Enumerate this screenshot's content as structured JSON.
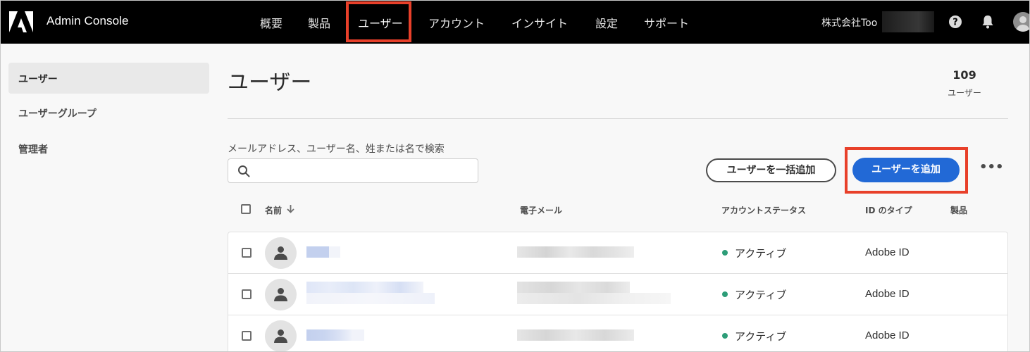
{
  "header": {
    "app_title": "Admin Console",
    "nav": [
      "概要",
      "製品",
      "ユーザー",
      "アカウント",
      "インサイト",
      "設定",
      "サポート"
    ],
    "active_nav": "ユーザー",
    "org_name": "株式会社Too"
  },
  "sidebar": {
    "items": [
      {
        "label": "ユーザー",
        "active": true
      },
      {
        "label": "ユーザーグループ",
        "active": false
      },
      {
        "label": "管理者",
        "active": false
      }
    ]
  },
  "main": {
    "title": "ユーザー",
    "user_count": "109",
    "user_count_label": "ユーザー",
    "search_label": "メールアドレス、ユーザー名、姓または名で検索",
    "search_value": "",
    "bulk_add_label": "ユーザーを一括追加",
    "add_user_label": "ユーザーを追加",
    "more_label": "•••"
  },
  "table": {
    "columns": [
      "名前",
      "電子メール",
      "アカウントステータス",
      "ID のタイプ",
      "製品"
    ],
    "rows": [
      {
        "status": "アクティブ",
        "id_type": "Adobe ID"
      },
      {
        "status": "アクティブ",
        "id_type": "Adobe ID"
      },
      {
        "status": "アクティブ",
        "id_type": "Adobe ID"
      }
    ]
  },
  "colors": {
    "topbar": "#000000",
    "accent_blue": "#2269d6",
    "highlight_red": "#e8402a",
    "status_active": "#2d9d78"
  }
}
